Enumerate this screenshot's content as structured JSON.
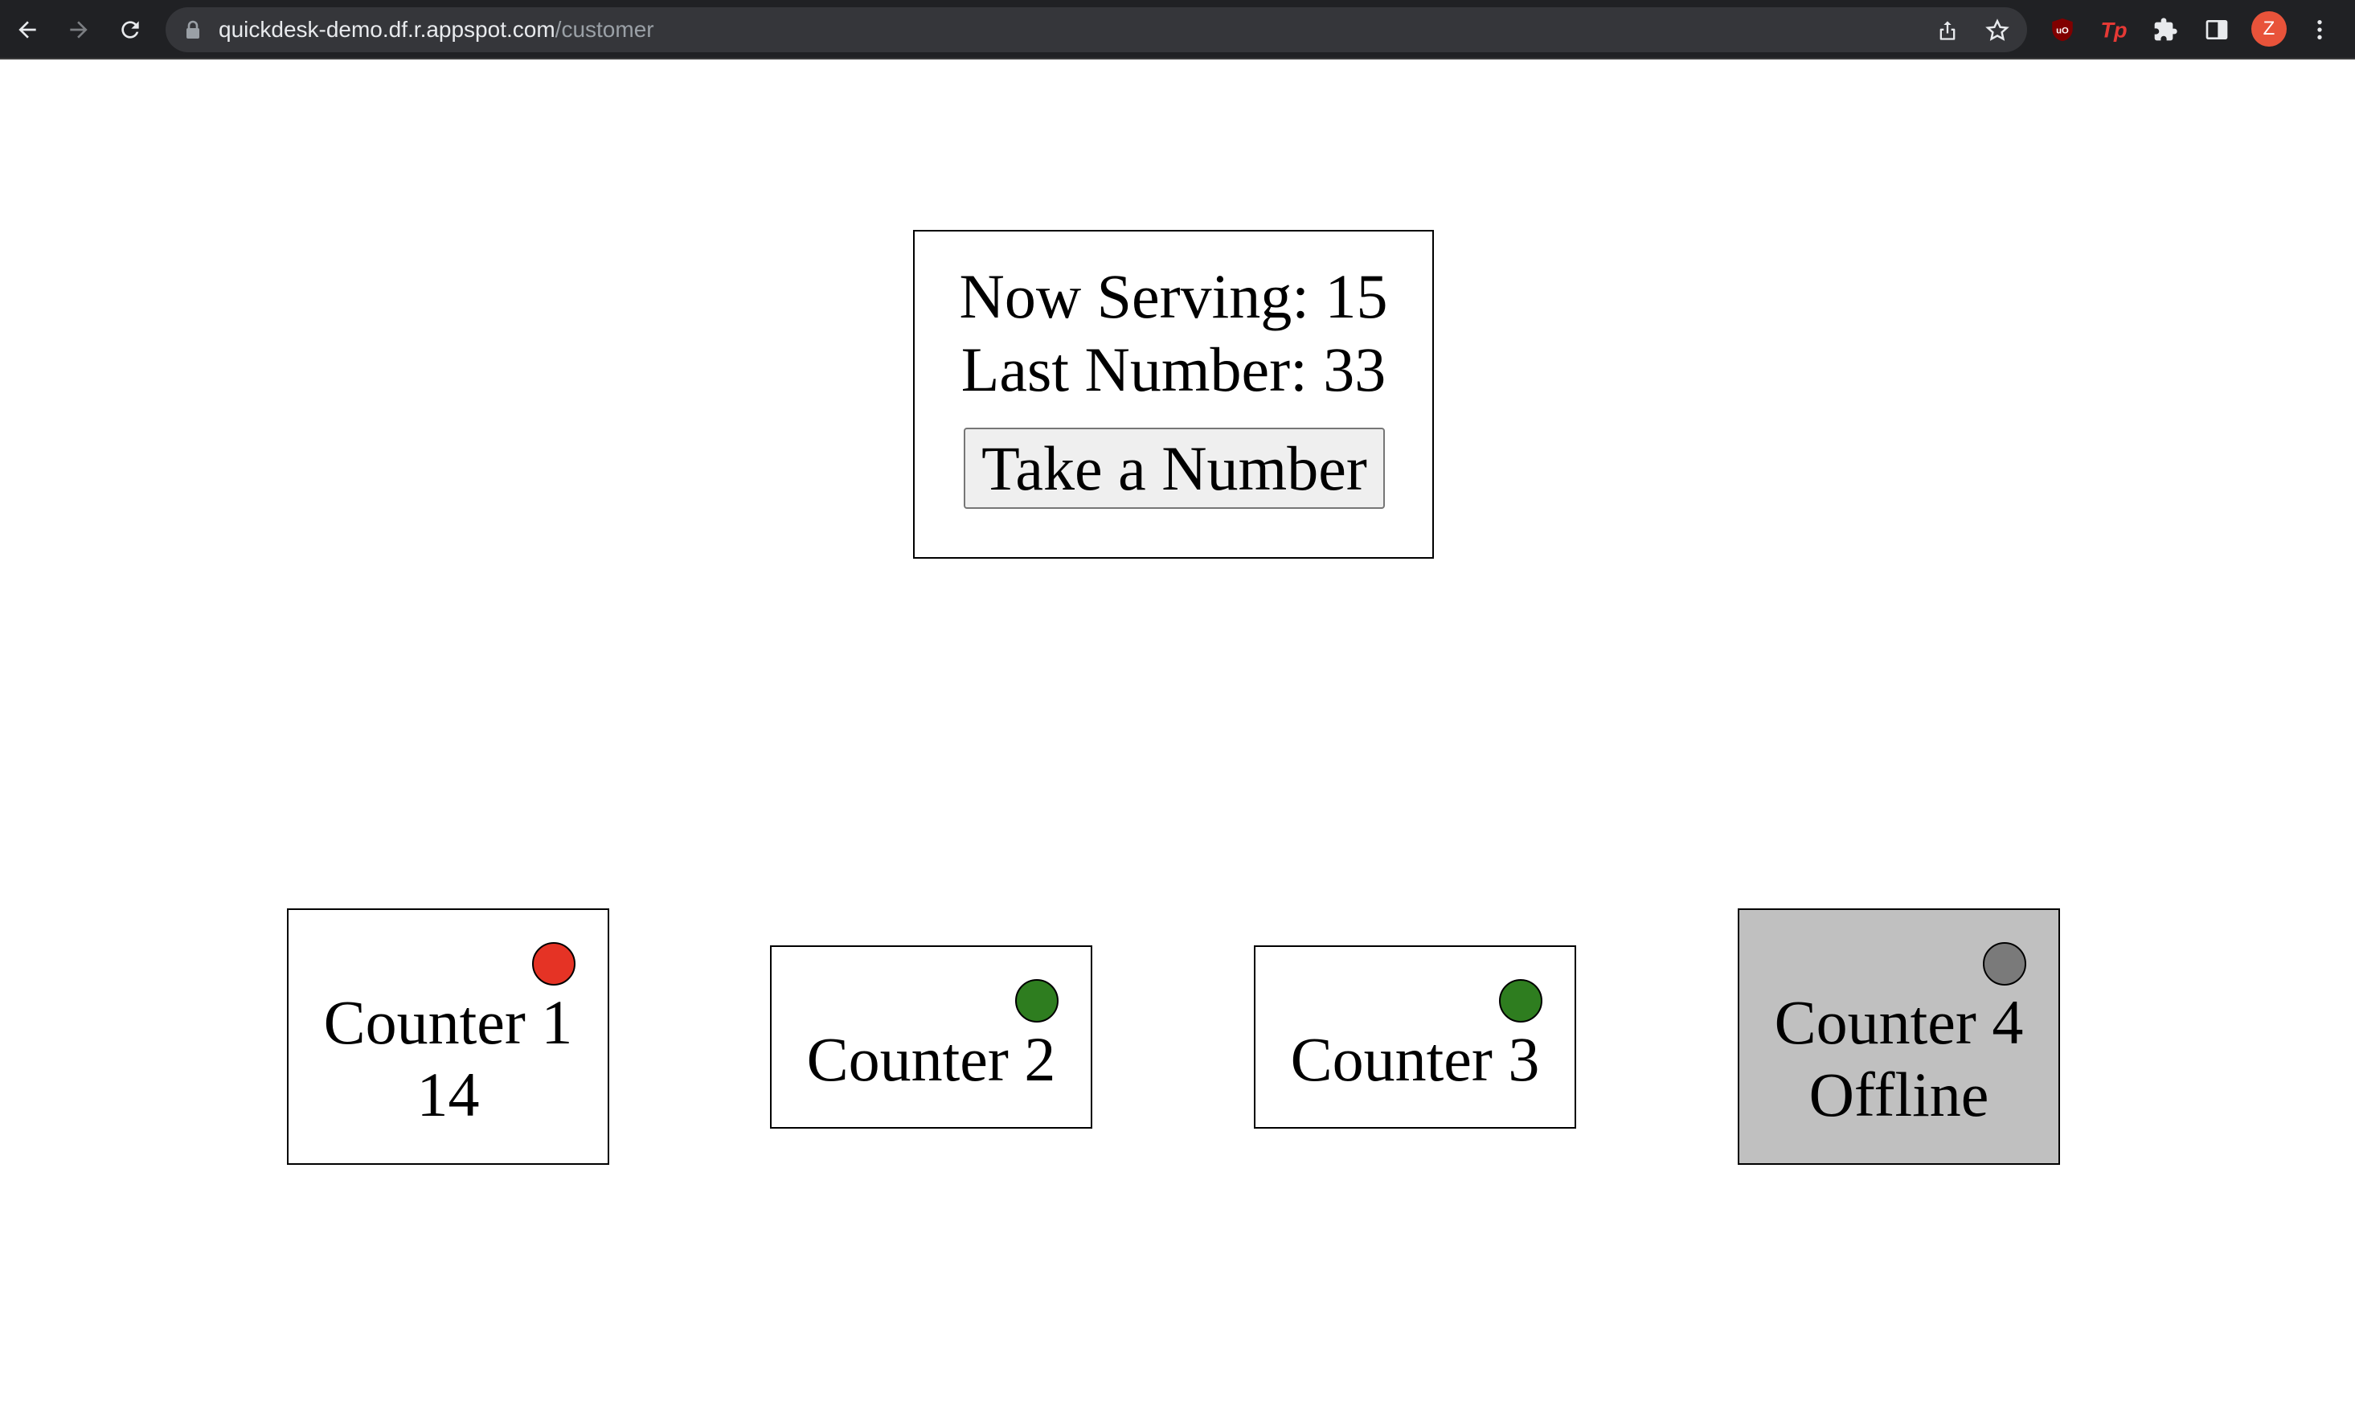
{
  "browser": {
    "url_host": "quickdesk-demo.df.r.appspot.com",
    "url_path": "/customer",
    "profile_initial": "Z"
  },
  "main": {
    "now_serving_label": "Now Serving: 15",
    "last_number_label": "Last Number: 33",
    "take_number_button": "Take a Number"
  },
  "counters": [
    {
      "name": "Counter 1",
      "detail": "14",
      "status": "busy",
      "status_color": "#e53325"
    },
    {
      "name": "Counter 2",
      "detail": "",
      "status": "available",
      "status_color": "#2e7d1f"
    },
    {
      "name": "Counter 3",
      "detail": "",
      "status": "available",
      "status_color": "#2e7d1f"
    },
    {
      "name": "Counter 4",
      "detail": "Offline",
      "status": "offline",
      "status_color": "#7a7a7a"
    }
  ]
}
